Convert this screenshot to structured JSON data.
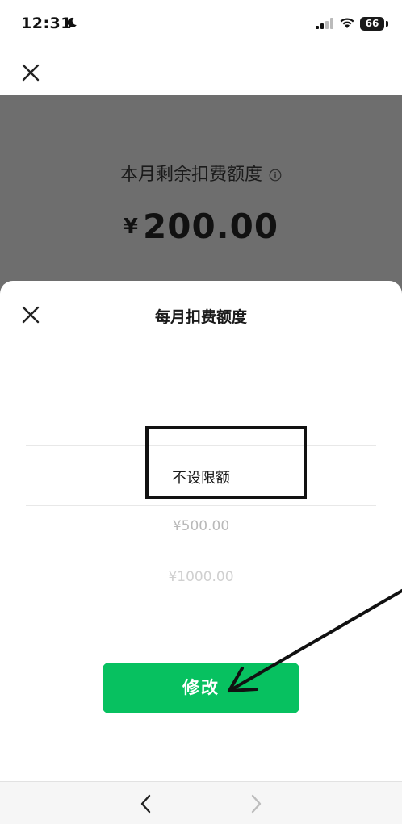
{
  "status_bar": {
    "time": "12:31",
    "battery": "66"
  },
  "header": {
    "quota_label": "本月剩余扣费额度",
    "currency": "¥",
    "amount": "200.00"
  },
  "sheet": {
    "title": "每月扣费额度",
    "options": [
      "不设限额",
      "¥500.00",
      "¥1000.00"
    ],
    "selected_index": 0,
    "confirm_label": "修改"
  },
  "colors": {
    "accent_green": "#07c160",
    "dim_overlay": "#6e6e6e"
  },
  "icons": [
    "moon-icon",
    "signal-icon",
    "wifi-icon",
    "battery-icon",
    "close-icon",
    "info-icon",
    "back-icon",
    "forward-icon"
  ]
}
